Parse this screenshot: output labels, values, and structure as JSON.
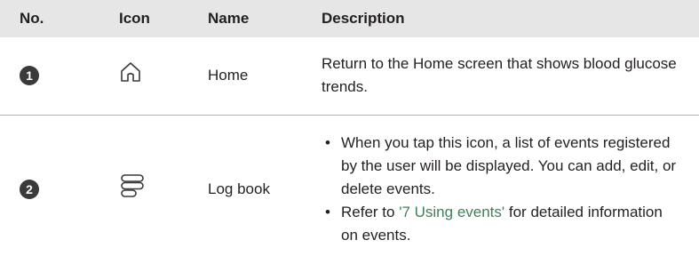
{
  "headers": {
    "no": "No.",
    "icon": "Icon",
    "name": "Name",
    "description": "Description"
  },
  "rows": [
    {
      "number": "1",
      "icon": "home-icon",
      "name": "Home",
      "description": "Return to the Home screen that shows blood glucose trends."
    },
    {
      "number": "2",
      "icon": "log-book-icon",
      "name": "Log book",
      "bullets": [
        {
          "text": "When you tap this icon, a list of events registered by the user will be displayed. You can add, edit, or delete events."
        },
        {
          "pre": "Refer to ",
          "link": "'7 Using events'",
          "post": " for detailed information on events."
        }
      ]
    }
  ],
  "colors": {
    "header_bg": "#e6e6e6",
    "link": "#3f7f5a",
    "badge": "#3a3a3a"
  }
}
